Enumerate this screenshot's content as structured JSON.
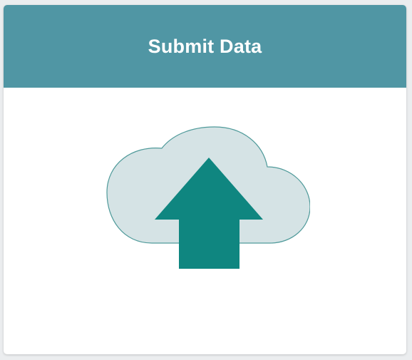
{
  "card": {
    "title": "Submit Data",
    "icon": "cloud-upload-icon"
  },
  "colors": {
    "header_background": "#5096a4",
    "title_text": "#ffffff",
    "card_background": "#ffffff",
    "cloud_fill": "#d5e3e5",
    "cloud_stroke": "#4f9a9a",
    "arrow_fill": "#0f8680"
  }
}
